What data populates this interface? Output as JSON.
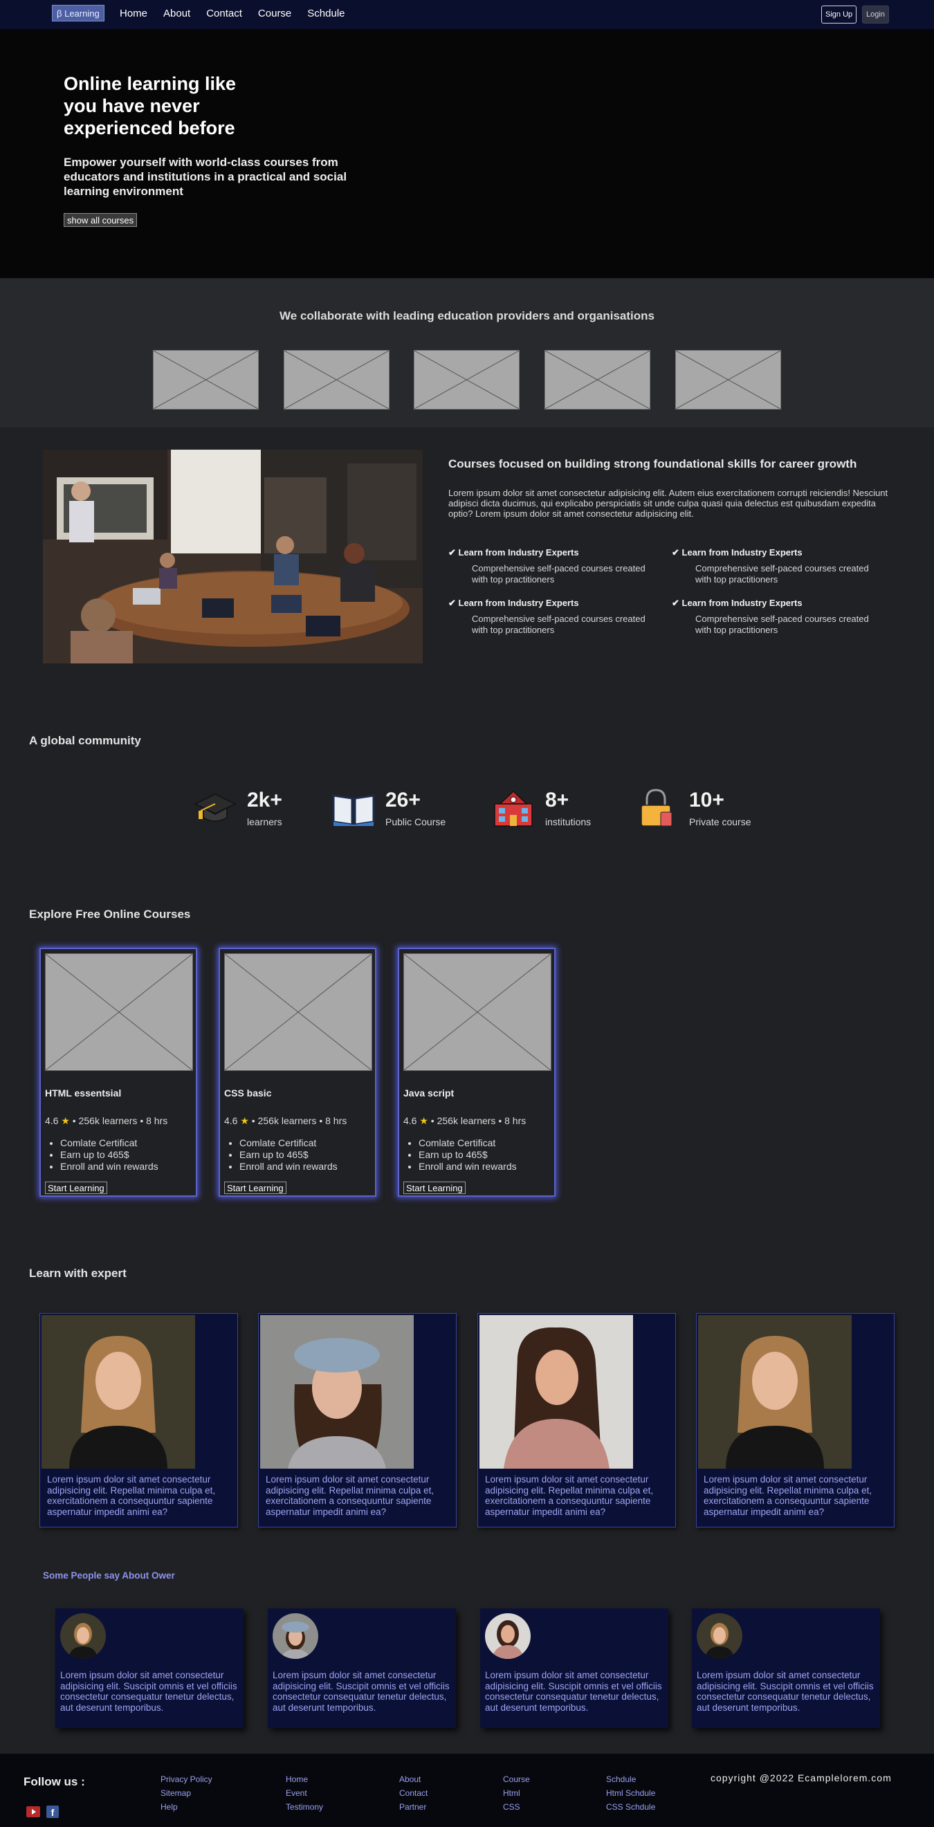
{
  "nav": {
    "brand": "β Learning",
    "links": [
      "Home",
      "About",
      "Contact",
      "Course",
      "Schdule"
    ],
    "signup": "Sign Up",
    "login": "Login"
  },
  "hero": {
    "title": "Online learning like you have never experienced before",
    "subtitle": "Empower yourself with world-class courses from educators and institutions in a practical and social learning environment",
    "button": "show all courses"
  },
  "partners": {
    "title": "We collaborate with leading education providers and organisations",
    "logo_count": 5
  },
  "feature": {
    "title": "Courses focused on building strong foundational skills for career growth",
    "text": "Lorem ipsum dolor sit amet consectetur adipisicing elit. Autem eius exercitationem corrupti reiciendis! Nesciunt adipisci dicta ducimus, qui explicabo perspiciatis sit unde culpa quasi quia delectus est quibusdam expedita optio? Lorem ipsum dolor sit amet consectetur adipisicing elit.",
    "items": [
      {
        "title": "✔ Learn from Industry Experts",
        "desc": "Comprehensive self-paced courses created with top practitioners"
      },
      {
        "title": "✔ Learn from Industry Experts",
        "desc": "Comprehensive self-paced courses created with top practitioners"
      },
      {
        "title": "✔ Learn from Industry Experts",
        "desc": "Comprehensive self-paced courses created with top practitioners"
      },
      {
        "title": "✔ Learn from Industry Experts",
        "desc": "Comprehensive self-paced courses created with top practitioners"
      }
    ]
  },
  "community": {
    "title": "A global community",
    "stats": [
      {
        "value": "2k+",
        "label": "learners",
        "icon": "graduation-cap-icon"
      },
      {
        "value": "26+",
        "label": "Public Course",
        "icon": "open-book-icon"
      },
      {
        "value": "8+",
        "label": "institutions",
        "icon": "school-building-icon"
      },
      {
        "value": "10+",
        "label": "Private course",
        "icon": "lock-icon"
      }
    ]
  },
  "courses": {
    "title": "Explore Free Online Courses",
    "items": [
      {
        "name": "HTML essentsial",
        "rating": "4.6",
        "meta": " • 256k learners • 8 hrs",
        "perks": [
          "Comlate Certificat",
          "Earn up to 465$",
          "Enroll and win rewards"
        ],
        "button": "Start Learning"
      },
      {
        "name": "CSS basic",
        "rating": "4.6",
        "meta": " • 256k learners • 8 hrs",
        "perks": [
          "Comlate Certificat",
          "Earn up to 465$",
          "Enroll and win rewards"
        ],
        "button": "Start Learning"
      },
      {
        "name": "Java script",
        "rating": "4.6",
        "meta": " • 256k learners • 8 hrs",
        "perks": [
          "Comlate Certificat",
          "Earn up to 465$",
          "Enroll and win rewards"
        ],
        "button": "Start Learning"
      }
    ]
  },
  "experts": {
    "title": "Learn with expert",
    "items": [
      {
        "text": "Lorem ipsum dolor sit amet consectetur adipisicing elit. Repellat minima culpa et, exercitationem a consequuntur sapiente aspernatur impedit animi ea?"
      },
      {
        "text": "Lorem ipsum dolor sit amet consectetur adipisicing elit. Repellat minima culpa et, exercitationem a consequuntur sapiente aspernatur impedit animi ea?"
      },
      {
        "text": "Lorem ipsum dolor sit amet consectetur adipisicing elit. Repellat minima culpa et, exercitationem a consequuntur sapiente aspernatur impedit animi ea?"
      },
      {
        "text": "Lorem ipsum dolor sit amet consectetur adipisicing elit. Repellat minima culpa et, exercitationem a consequuntur sapiente aspernatur impedit animi ea?"
      }
    ]
  },
  "testimonials": {
    "title": "Some People say About Ower",
    "items": [
      {
        "text": "Lorem ipsum dolor sit amet consectetur adipisicing elit. Suscipit omnis et vel officiis consectetur consequatur tenetur delectus, aut deserunt temporibus."
      },
      {
        "text": "Lorem ipsum dolor sit amet consectetur adipisicing elit. Suscipit omnis et vel officiis consectetur consequatur tenetur delectus, aut deserunt temporibus."
      },
      {
        "text": "Lorem ipsum dolor sit amet consectetur adipisicing elit. Suscipit omnis et vel officiis consectetur consequatur tenetur delectus, aut deserunt temporibus."
      },
      {
        "text": "Lorem ipsum dolor sit amet consectetur adipisicing elit. Suscipit omnis et vel officiis consectetur consequatur tenetur delectus, aut deserunt temporibus."
      }
    ]
  },
  "footer": {
    "follow": "Follow us :",
    "columns": [
      [
        "Privacy Policy",
        "Sitemap",
        "Help"
      ],
      [
        "Home",
        "Event",
        "Testimony"
      ],
      [
        "About",
        "Contact",
        "Partner"
      ],
      [
        "Course",
        "Html",
        "CSS"
      ],
      [
        "Schdule",
        "Html Schdule",
        "CSS Schdule"
      ]
    ],
    "copyright": "copyright @2022 Ecamplelorem.com",
    "social_icons": [
      "youtube-icon",
      "facebook-icon"
    ]
  },
  "colors": {
    "nav_bg": "#0b0f2e",
    "card_glow": "#5a63c9",
    "link": "#9aa0ef",
    "star": "#f5c518"
  }
}
